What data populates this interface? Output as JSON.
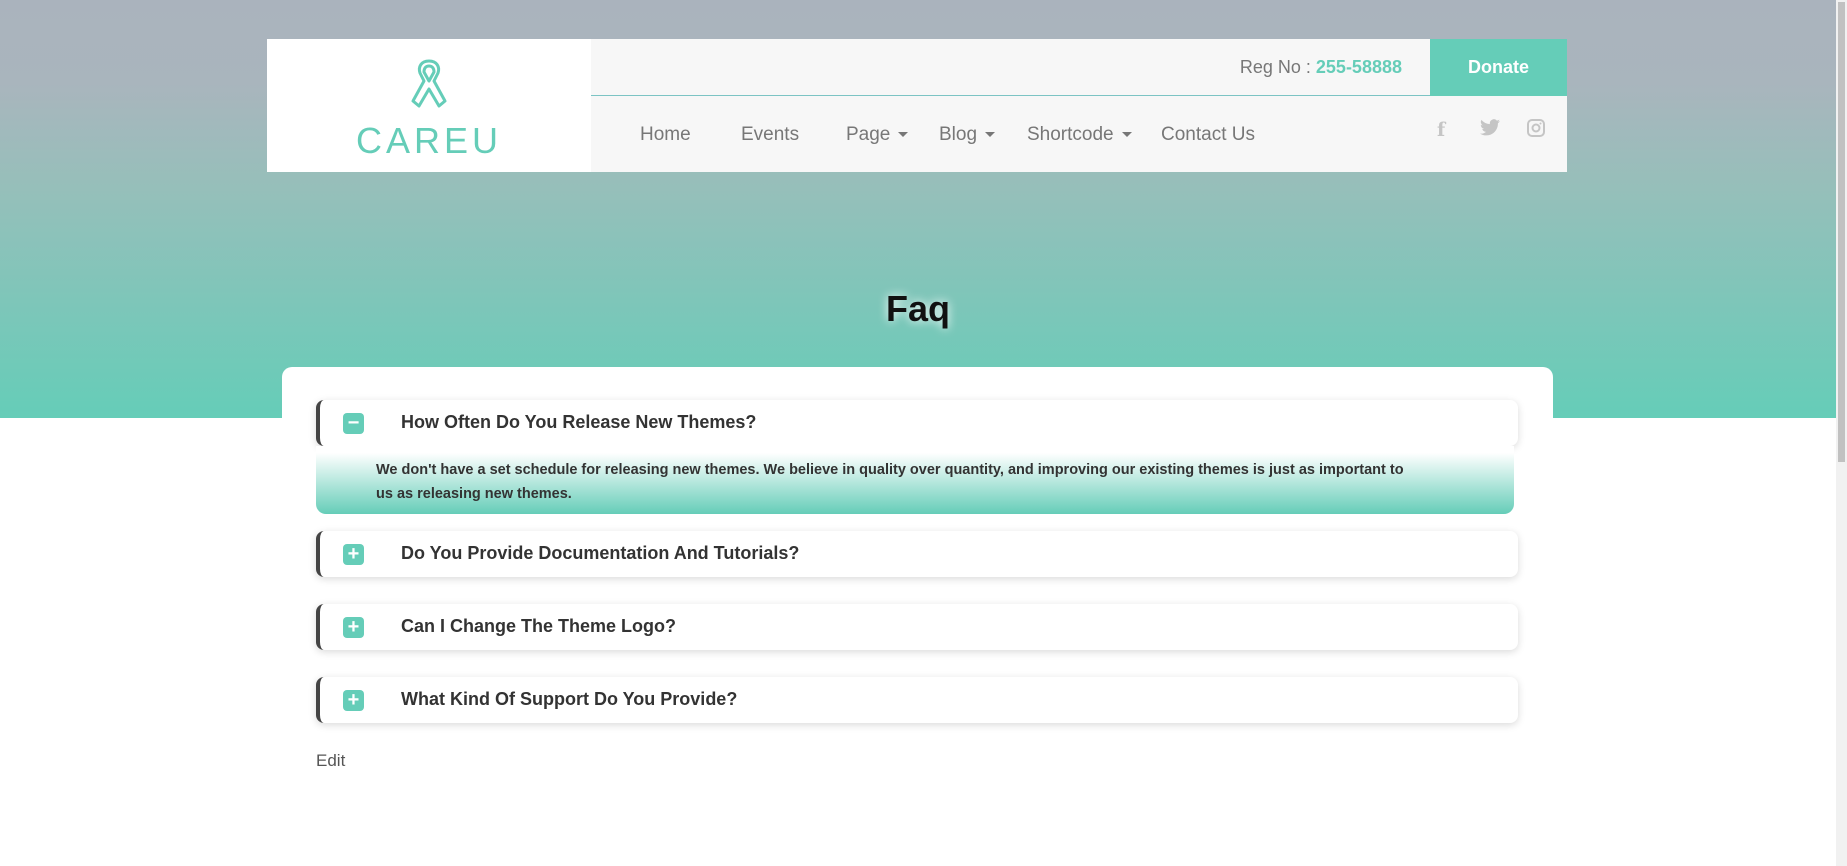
{
  "header": {
    "brand": "CAREU",
    "reg_label": "Reg No :",
    "reg_number": "255-58888",
    "donate_label": "Donate",
    "nav": [
      {
        "label": "Home",
        "dropdown": false
      },
      {
        "label": "Events",
        "dropdown": false
      },
      {
        "label": "Page",
        "dropdown": true
      },
      {
        "label": "Blog",
        "dropdown": true
      },
      {
        "label": "Shortcode",
        "dropdown": true
      },
      {
        "label": "Contact Us",
        "dropdown": false
      }
    ],
    "social": [
      "facebook-icon",
      "twitter-icon",
      "instagram-icon"
    ]
  },
  "page_title": "Faq",
  "faq": [
    {
      "question": "How Often Do You Release New Themes?",
      "expanded": true,
      "answer": "We don't have a set schedule for releasing new themes. We believe in quality over quantity, and improving our existing themes is just as important to us as releasing new themes."
    },
    {
      "question": "Do You Provide Documentation And Tutorials?",
      "expanded": false
    },
    {
      "question": "Can I Change The Theme Logo?",
      "expanded": false
    },
    {
      "question": "What Kind Of Support Do You Provide?",
      "expanded": false
    }
  ],
  "edit_label": "Edit",
  "colors": {
    "accent": "#65cdb8",
    "text": "#333333"
  }
}
